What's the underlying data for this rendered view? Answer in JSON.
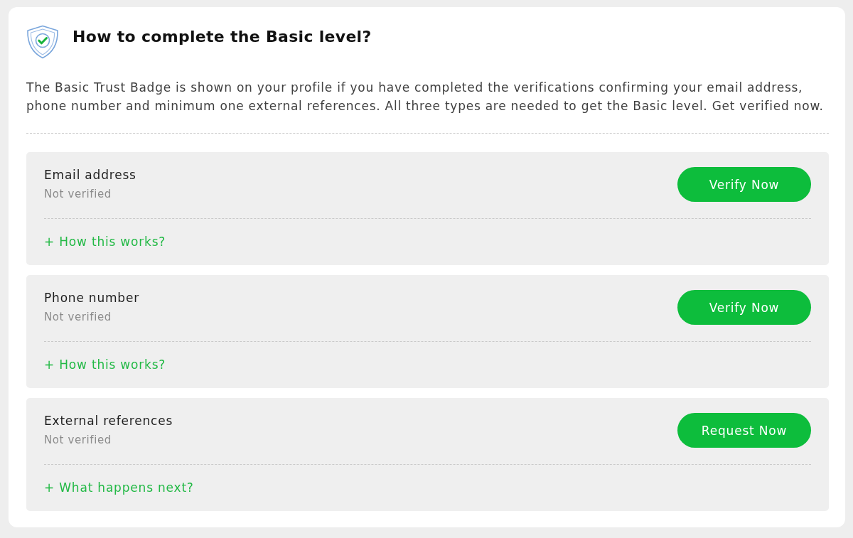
{
  "header": {
    "title": "How to complete the Basic level?"
  },
  "intro": "The Basic Trust Badge is shown on your profile if you have completed the verifications confirming your email address, phone number and minimum one external references. All three types are needed to get the Basic level. Get verified now.",
  "steps": [
    {
      "title": "Email address",
      "status": "Not verified",
      "button": "Verify Now",
      "link": "+ How this works?"
    },
    {
      "title": "Phone number",
      "status": "Not verified",
      "button": "Verify Now",
      "link": "+ How this works?"
    },
    {
      "title": "External references",
      "status": "Not verified",
      "button": "Request Now",
      "link": "+ What happens next?"
    }
  ]
}
